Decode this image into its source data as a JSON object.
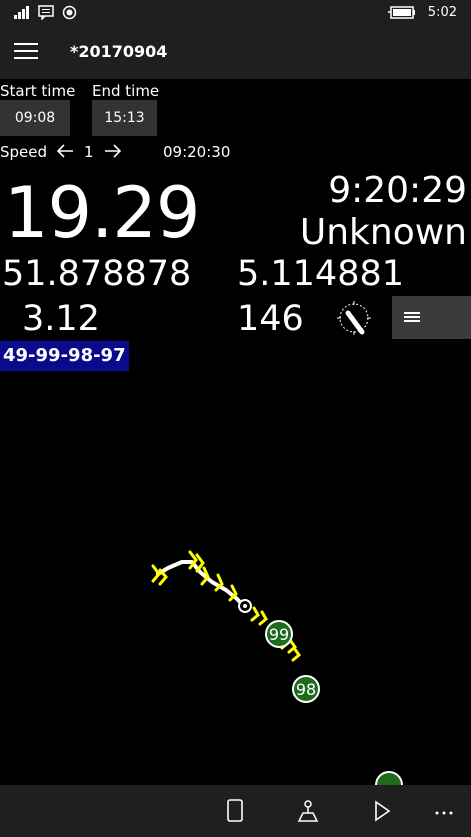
{
  "status": {
    "time": "5:02",
    "icons": [
      "signal-icon",
      "message-icon",
      "record-icon",
      "battery-charging-icon"
    ]
  },
  "header": {
    "title": "*20170904",
    "menu_icon": "hamburger-icon"
  },
  "times": {
    "start_label": "Start time",
    "start_value": "09:08",
    "end_label": "End time",
    "end_value": "15:13"
  },
  "playback": {
    "speed_label": "Speed",
    "speed_value": "1",
    "current_time": "09:20:30"
  },
  "readouts": {
    "speed": "19.29",
    "time": "9:20:29",
    "heading": "Unknown",
    "latitude": "51.878878",
    "longitude": "5.114881",
    "value_a": "3.12",
    "value_b": "146"
  },
  "route_label": "49-99-98-97",
  "map": {
    "markers": [
      {
        "label": "99"
      },
      {
        "label": "98"
      }
    ],
    "colors": {
      "track": "#ffffff",
      "chevron": "#ffff00",
      "marker": "#1e6b1e"
    }
  },
  "app_bar": {
    "buttons": [
      "page-icon",
      "map-route-icon",
      "play-icon",
      "more-icon"
    ]
  }
}
